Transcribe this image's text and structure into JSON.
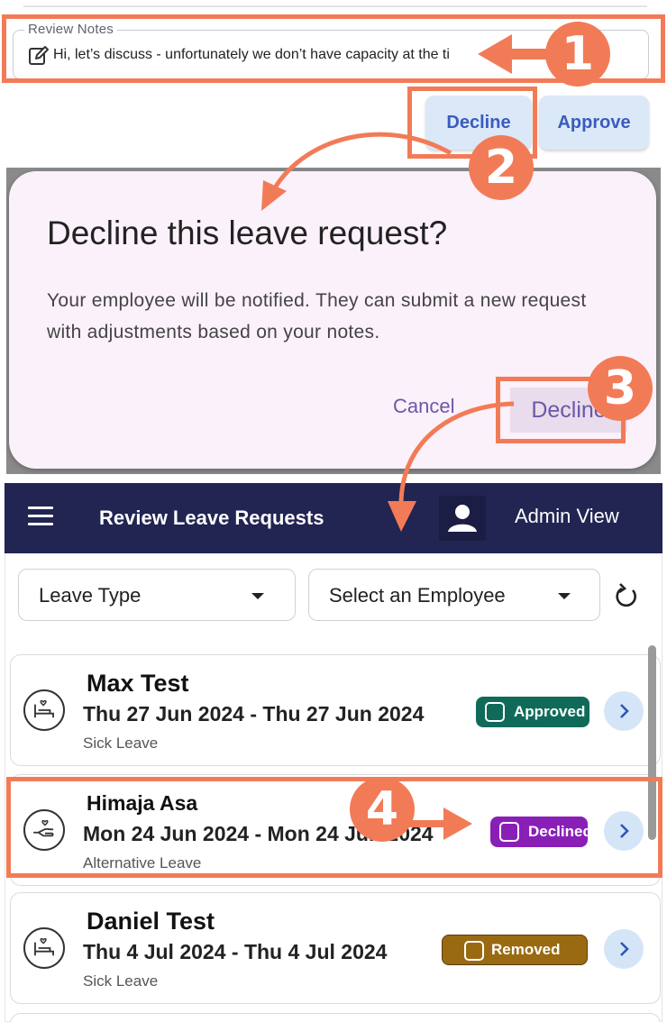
{
  "review_notes": {
    "label": "Review Notes",
    "value": "Hi, let’s discuss - unfortunately we don’t have capacity at the ti"
  },
  "review_actions": {
    "decline_label": "Decline",
    "approve_label": "Approve"
  },
  "dialog": {
    "title": "Decline this leave request?",
    "body": "Your employee will be notified. They can submit a new request with adjustments based on your notes.",
    "cancel_label": "Cancel",
    "decline_label": "Decline"
  },
  "app_bar": {
    "title": "Review Leave Requests",
    "role_label": "Admin View"
  },
  "filters": {
    "leave_type_label": "Leave Type",
    "employee_label": "Select an Employee"
  },
  "requests": [
    {
      "name": "Max Test",
      "dates": "Thu 27 Jun 2024 - Thu 27 Jun 2024",
      "type": "Sick Leave",
      "status": "Approved",
      "status_color": "#0f6a5a"
    },
    {
      "name": "Himaja Asa",
      "dates": "Mon 24 Jun 2024 - Mon 24 Jun 2024",
      "type": "Alternative Leave",
      "status": "Declined",
      "status_color": "#8a1fb8"
    },
    {
      "name": "Daniel Test",
      "dates": "Thu 4 Jul 2024 - Thu 4 Jul 2024",
      "type": "Sick Leave",
      "status": "Removed",
      "status_color": "#9a6a12"
    }
  ],
  "step_markers": [
    "1",
    "2",
    "3",
    "4"
  ],
  "colors": {
    "annotation": "#f27b57",
    "app_bar": "#222452",
    "button_bg": "#dbe8f8",
    "button_text": "#3b5bbd",
    "dialog_bg": "#fbf1fa",
    "dialog_accent": "#6a58a8"
  }
}
